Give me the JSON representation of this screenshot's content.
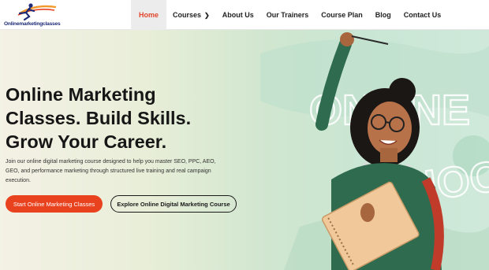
{
  "site": {
    "logo_text": "Onlinemarketingclasses",
    "logo_icon": "running-figure-logo"
  },
  "nav": {
    "items": [
      {
        "label": "Home",
        "active": true
      },
      {
        "label": "Courses",
        "has_submenu": true
      },
      {
        "label": "About Us"
      },
      {
        "label": "Our Trainers"
      },
      {
        "label": "Course Plan"
      },
      {
        "label": "Blog"
      },
      {
        "label": "Contact Us"
      }
    ]
  },
  "hero": {
    "title_lines": [
      "Online Marketing",
      "Classes. Build Skills.",
      "Grow Your Career."
    ],
    "description": "Join our online digital marketing course designed to help you master SEO, PPC, AEO, GEO, and performance marketing through structured live training and real campaign execution.",
    "primary_button": "Start Online Marketing Classes",
    "secondary_button": "Explore Online Digital Marketing Course",
    "background_text": [
      "ONLINE",
      "SCHOOL"
    ]
  },
  "colors": {
    "accent": "#e8421f",
    "nav_active": "#e2462b",
    "brand_navy": "#1d2b78"
  }
}
